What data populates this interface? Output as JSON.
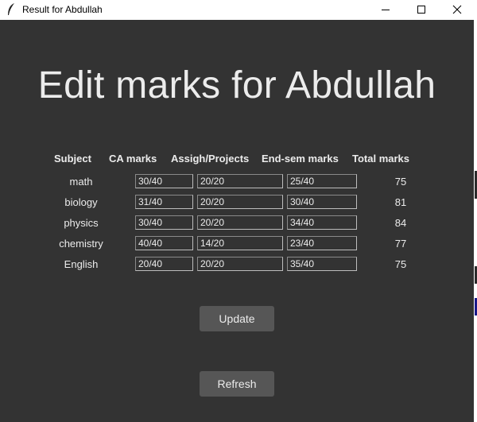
{
  "window": {
    "title": "Result for Abdullah"
  },
  "heading": "Edit marks for Abdullah",
  "columns": [
    "Subject",
    "CA marks",
    "Assigh/Projects",
    "End-sem marks",
    "Total marks"
  ],
  "rows": [
    {
      "subject": "math",
      "ca": "30/40",
      "assign": "20/20",
      "endsem": "25/40",
      "total": "75"
    },
    {
      "subject": "biology",
      "ca": "31/40",
      "assign": "20/20",
      "endsem": "30/40",
      "total": "81"
    },
    {
      "subject": "physics",
      "ca": "30/40",
      "assign": "20/20",
      "endsem": "34/40",
      "total": "84"
    },
    {
      "subject": "chemistry",
      "ca": "40/40",
      "assign": "14/20",
      "endsem": "23/40",
      "total": "77"
    },
    {
      "subject": "English",
      "ca": "20/40",
      "assign": "20/20",
      "endsem": "35/40",
      "total": "75"
    }
  ],
  "buttons": {
    "update": "Update",
    "refresh": "Refresh"
  },
  "colors": {
    "background": "#333333",
    "text": "#ececec",
    "button": "#565656"
  },
  "icons": {
    "app": "feather-icon",
    "minimize": "minimize-icon",
    "maximize": "maximize-icon",
    "close": "close-icon"
  }
}
